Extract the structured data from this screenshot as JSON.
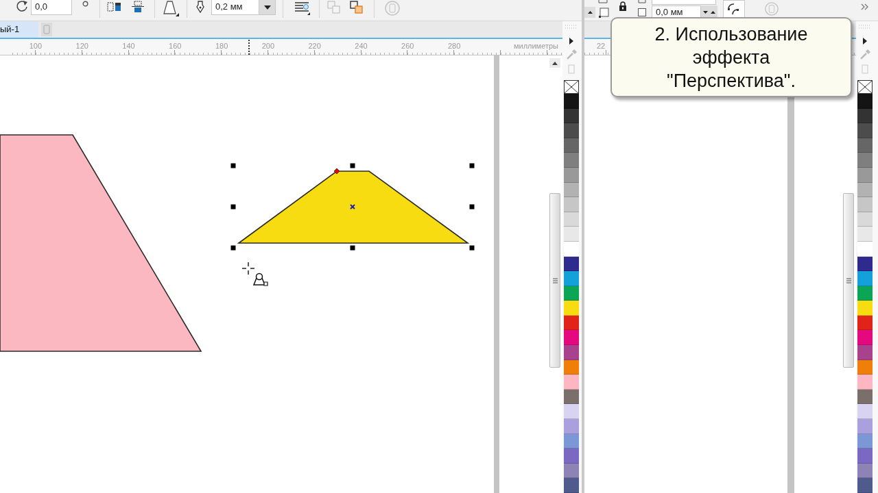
{
  "left_window": {
    "toolbar": {
      "angle_field": {
        "value": "0,0"
      },
      "outline_width_field": {
        "value": "0,2 мм"
      },
      "buttons": [
        {
          "disabled": false
        },
        {
          "disabled": false
        },
        {
          "disabled": false
        },
        {
          "disabled": false
        },
        {
          "disabled": true
        },
        {
          "disabled": false
        },
        {
          "disabled": true
        }
      ]
    },
    "document_tab": {
      "label": "ый-1",
      "selected": true
    },
    "ruler": {
      "labels": [
        "100",
        "120",
        "140",
        "160",
        "180",
        "200",
        "220",
        "240",
        "260",
        "280"
      ],
      "unit": "миллиметры"
    },
    "canvas": {
      "shapes": [
        {
          "color": "#fbb8c1",
          "selected": false
        },
        {
          "color": "#f7dc12",
          "selected": true
        }
      ]
    },
    "palette": [
      {
        "color": "#141414"
      },
      {
        "color": "#333333"
      },
      {
        "color": "#4c4c4c"
      },
      {
        "color": "#666666"
      },
      {
        "color": "#7f7f7f"
      },
      {
        "color": "#999999"
      },
      {
        "color": "#b2b2b2"
      },
      {
        "color": "#c6c6c6"
      },
      {
        "color": "#d9d9d9"
      },
      {
        "color": "#e8e8e8"
      },
      {
        "color": "#ffffff"
      },
      {
        "color": "#2e2a8e"
      },
      {
        "color": "#14a0d8"
      },
      {
        "color": "#0aa555"
      },
      {
        "color": "#f7dc12"
      },
      {
        "color": "#e2231a"
      },
      {
        "color": "#e4097f"
      },
      {
        "color": "#a9428c"
      },
      {
        "color": "#f07f09"
      },
      {
        "color": "#fcb7c3"
      },
      {
        "color": "#7b6f6b"
      },
      {
        "color": "#d9d3f2"
      },
      {
        "color": "#a9a0dd"
      },
      {
        "color": "#7b97d6"
      },
      {
        "color": "#7a68c2"
      },
      {
        "color": "#8d83b4"
      },
      {
        "color": "#4f5b8d"
      }
    ]
  },
  "right_window": {
    "toolbar": {
      "position_field": {
        "value": "0,0 мм"
      },
      "buttons": [
        {
          "disabled": false
        },
        {
          "disabled": true
        }
      ]
    },
    "ruler": {
      "labels": [
        "22"
      ]
    },
    "palette": [
      {
        "color": "#141414"
      },
      {
        "color": "#333333"
      },
      {
        "color": "#4c4c4c"
      },
      {
        "color": "#666666"
      },
      {
        "color": "#7f7f7f"
      },
      {
        "color": "#999999"
      },
      {
        "color": "#b2b2b2"
      },
      {
        "color": "#c6c6c6"
      },
      {
        "color": "#d9d9d9"
      },
      {
        "color": "#e8e8e8"
      },
      {
        "color": "#ffffff"
      },
      {
        "color": "#2e2a8e"
      },
      {
        "color": "#14a0d8"
      },
      {
        "color": "#0aa555"
      },
      {
        "color": "#f7dc12"
      },
      {
        "color": "#e2231a"
      },
      {
        "color": "#e4097f"
      },
      {
        "color": "#a9428c"
      },
      {
        "color": "#f07f09"
      },
      {
        "color": "#fcb7c3"
      },
      {
        "color": "#7b6f6b"
      },
      {
        "color": "#d9d3f2"
      },
      {
        "color": "#a9a0dd"
      },
      {
        "color": "#7b97d6"
      },
      {
        "color": "#7a68c2"
      },
      {
        "color": "#8d83b4"
      },
      {
        "color": "#4f5b8d"
      }
    ]
  },
  "callout": {
    "text": "2. Использование эффекта \"Перспектива\"."
  }
}
